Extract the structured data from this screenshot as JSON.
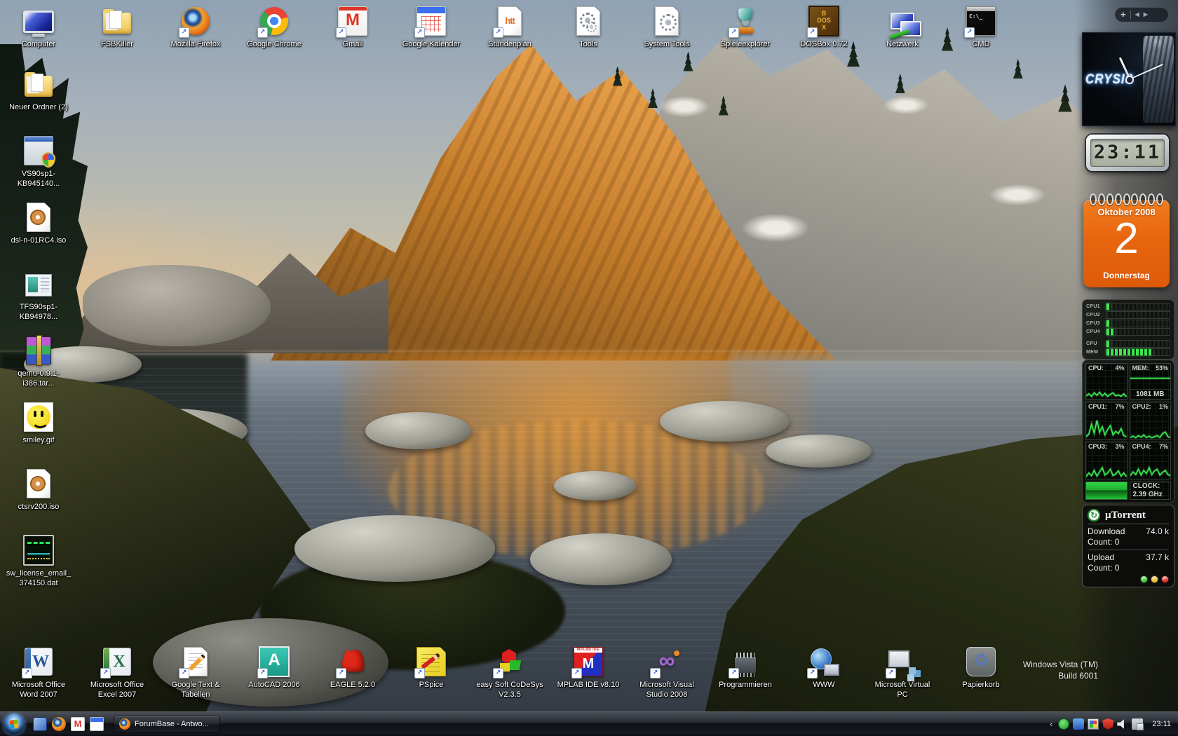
{
  "desktop": {
    "top_row": [
      {
        "label": "Computer",
        "icon": "computer",
        "shortcut": false
      },
      {
        "label": "FSBKiller",
        "icon": "folder",
        "shortcut": false
      },
      {
        "label": "Mozilla Firefox",
        "icon": "firefox",
        "shortcut": true
      },
      {
        "label": "Google Chrome",
        "icon": "chrome",
        "shortcut": true
      },
      {
        "label": "Gmail",
        "icon": "gmail",
        "shortcut": true
      },
      {
        "label": "Google Kalender",
        "icon": "gcal",
        "shortcut": true
      },
      {
        "label": "Stundenplan",
        "icon": "html-doc",
        "shortcut": true
      },
      {
        "label": "Tools",
        "icon": "tools-doc",
        "shortcut": false
      },
      {
        "label": "System Tools",
        "icon": "systools-doc",
        "shortcut": false
      },
      {
        "label": "Spieleexplorer",
        "icon": "games",
        "shortcut": true
      },
      {
        "label": "DOSBox 0.72",
        "icon": "dosbox",
        "shortcut": true
      },
      {
        "label": "Netzwerk",
        "icon": "network",
        "shortcut": false
      },
      {
        "label": "CMD",
        "icon": "cmd",
        "shortcut": true
      }
    ],
    "left_column": [
      {
        "label": "Neuer Ordner (2)",
        "icon": "folder",
        "shortcut": false
      },
      {
        "label": "VS90sp1-KB945140...",
        "icon": "installer",
        "shortcut": false
      },
      {
        "label": "dsl-n-01RC4.iso",
        "icon": "iso",
        "shortcut": false
      },
      {
        "label": "TFS90sp1-KB94978...",
        "icon": "app-window",
        "shortcut": false
      },
      {
        "label": "qemu-0.9.1-i386.tar...",
        "icon": "rar",
        "shortcut": false
      },
      {
        "label": "smiley.gif",
        "icon": "smiley",
        "shortcut": false
      },
      {
        "label": "ctsrv200.iso",
        "icon": "iso",
        "shortcut": false
      },
      {
        "label": "sw_license_email_374150.dat",
        "icon": "waveform",
        "shortcut": false
      }
    ],
    "bottom_row": [
      {
        "label": "Microsoft Office Word 2007",
        "icon": "word",
        "shortcut": true
      },
      {
        "label": "Microsoft Office Excel 2007",
        "icon": "excel",
        "shortcut": true
      },
      {
        "label": "Google Text & Tabellen",
        "icon": "gdocs",
        "shortcut": true
      },
      {
        "label": "AutoCAD 2006",
        "icon": "autocad",
        "shortcut": true
      },
      {
        "label": "EAGLE 5.2.0",
        "icon": "eagle",
        "shortcut": true
      },
      {
        "label": "PSpice",
        "icon": "pspice",
        "shortcut": true
      },
      {
        "label": "easy Soft CoDeSys V2.3.5",
        "icon": "codesys",
        "shortcut": true
      },
      {
        "label": "MPLAB IDE v8.10",
        "icon": "mplab",
        "shortcut": true
      },
      {
        "label": "Microsoft Visual Studio 2008",
        "icon": "visual-studio",
        "shortcut": true
      },
      {
        "label": "Programmieren",
        "icon": "chip",
        "shortcut": true
      },
      {
        "label": "WWW",
        "icon": "globe",
        "shortcut": true
      },
      {
        "label": "Microsoft Virtual PC",
        "icon": "virtual-pc",
        "shortcut": true
      },
      {
        "label": "Papierkorb",
        "icon": "recycle-bin",
        "shortcut": false
      }
    ]
  },
  "sidebar": {
    "controls": {
      "add": "+",
      "prev": "◀",
      "next": "▶"
    },
    "analog_clock": {
      "brand": "CRYSIS"
    },
    "digital_clock": {
      "time": "23:11"
    },
    "calendar": {
      "month": "Oktober 2008",
      "day": "2",
      "weekday": "Donnerstag"
    },
    "led_meter": {
      "cpu_rows": [
        {
          "label": "CPU1",
          "lit": 1
        },
        {
          "label": "CPU2",
          "lit": 0
        },
        {
          "label": "CPU3",
          "lit": 1
        },
        {
          "label": "CPU4",
          "lit": 2
        }
      ],
      "mem_rows": [
        {
          "label": "CPU",
          "lit": 1
        },
        {
          "label": "MEM",
          "lit": 11
        }
      ],
      "total_segments": 22
    },
    "monitor": {
      "cells": [
        {
          "label": "CPU:",
          "value": "4%",
          "type": "line",
          "spark": [
            12,
            20,
            10,
            24,
            14,
            26,
            12,
            22,
            10,
            18,
            24,
            12,
            16,
            10,
            20,
            8
          ]
        },
        {
          "label": "MEM:",
          "value": "53%",
          "type": "mem",
          "sub": "1081 MB",
          "spark": [
            68,
            68,
            68,
            68,
            68,
            68,
            68,
            68,
            68,
            68,
            68,
            68,
            68,
            68,
            68,
            68
          ]
        },
        {
          "label": "CPU1:",
          "value": "7%",
          "type": "line",
          "spark": [
            8,
            18,
            55,
            22,
            70,
            25,
            45,
            15,
            35,
            50,
            15,
            28,
            20,
            38,
            12,
            8
          ]
        },
        {
          "label": "CPU2:",
          "value": "1%",
          "type": "line",
          "spark": [
            5,
            10,
            4,
            12,
            6,
            14,
            5,
            10,
            4,
            8,
            12,
            5,
            20,
            26,
            8,
            5
          ]
        },
        {
          "label": "CPU3:",
          "value": "3%",
          "type": "line",
          "spark": [
            8,
            22,
            12,
            32,
            10,
            26,
            42,
            14,
            22,
            36,
            12,
            18,
            30,
            10,
            22,
            8
          ]
        },
        {
          "label": "CPU4:",
          "value": "7%",
          "type": "line",
          "spark": [
            12,
            26,
            16,
            36,
            14,
            32,
            20,
            42,
            16,
            30,
            36,
            14,
            24,
            32,
            16,
            12
          ]
        }
      ],
      "clock": {
        "label": "CLOCK:",
        "value": "2.39 GHz"
      }
    },
    "utorrent": {
      "title": "µTorrent",
      "download": {
        "label": "Download",
        "value": "74.0 k"
      },
      "download_count": "Count: 0",
      "upload": {
        "label": "Upload",
        "value": "37.7 k"
      },
      "upload_count": "Count: 0",
      "buttons": [
        {
          "name": "start",
          "color": "#35c828"
        },
        {
          "name": "pause",
          "color": "#e8b820"
        },
        {
          "name": "stop",
          "color": "#d82820"
        }
      ]
    }
  },
  "taskbar": {
    "quick_launch": [
      "app-window",
      "firefox",
      "gmail",
      "calendar"
    ],
    "task_button": {
      "label": "ForumBase - Antwo...",
      "icon": "firefox"
    },
    "tray": {
      "chevron": "‹",
      "icons": [
        "utorrent",
        "app",
        "display",
        "security-shield",
        "volume",
        "network"
      ],
      "clock": "23:11"
    }
  },
  "watermark": {
    "line1": "Windows Vista (TM)",
    "line2": "Build 6001"
  },
  "colors": {
    "calendar_orange": "#e8650f",
    "led_green": "#3ae84e",
    "graph_green": "#3df055",
    "taskbar_black": "#0d1014"
  }
}
